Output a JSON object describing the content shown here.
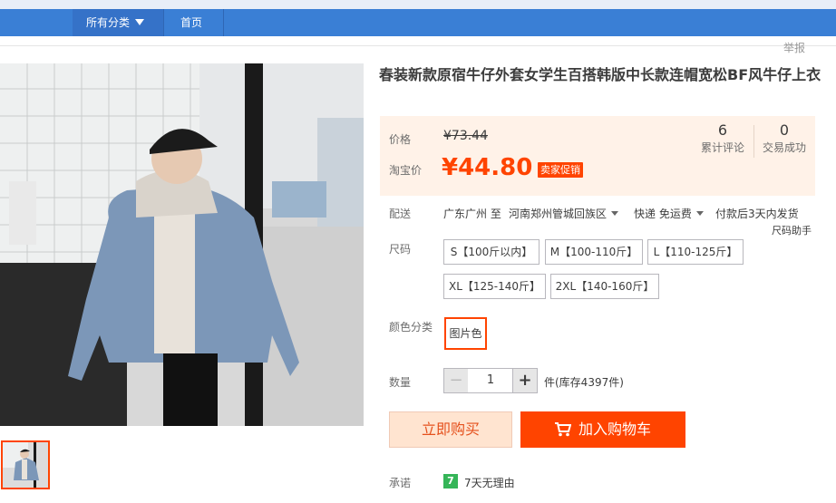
{
  "nav": {
    "all_categories": "所有分类",
    "home": "首页"
  },
  "report": "举报",
  "product": {
    "title": "春装新款原宿牛仔外套女学生百搭韩版中长款连帽宽松BF风牛仔上衣",
    "price_label": "价格",
    "original_price": "¥73.44",
    "taobao_price_label": "淘宝价",
    "current_price": "¥44.80",
    "promo_tag": "卖家促销",
    "stats": [
      {
        "value": "6",
        "label": "累计评论"
      },
      {
        "value": "0",
        "label": "交易成功"
      }
    ]
  },
  "shipping": {
    "label": "配送",
    "from": "广东广州 至",
    "to": "河南郑州管城回族区",
    "method": "快递 免运费",
    "dispatch": "付款后3天内发货"
  },
  "size": {
    "label": "尺码",
    "help": "尺码助手",
    "options": [
      "S【100斤以内】",
      "M【100-110斤】",
      "L【110-125斤】",
      "XL【125-140斤】",
      "2XL【140-160斤】"
    ]
  },
  "color": {
    "label": "颜色分类",
    "options": [
      "图片色"
    ]
  },
  "quantity": {
    "label": "数量",
    "value": "1",
    "minus": "−",
    "plus": "+",
    "stock": "件(库存4397件)"
  },
  "actions": {
    "buy_now": "立即购买",
    "add_to_cart": "加入购物车"
  },
  "promise": {
    "label": "承诺",
    "badge": "7",
    "text": "7天无理由"
  },
  "colors": {
    "brand_orange": "#ff4400",
    "nav_blue": "#3a7fd5",
    "price_bg": "#fff2e8"
  }
}
